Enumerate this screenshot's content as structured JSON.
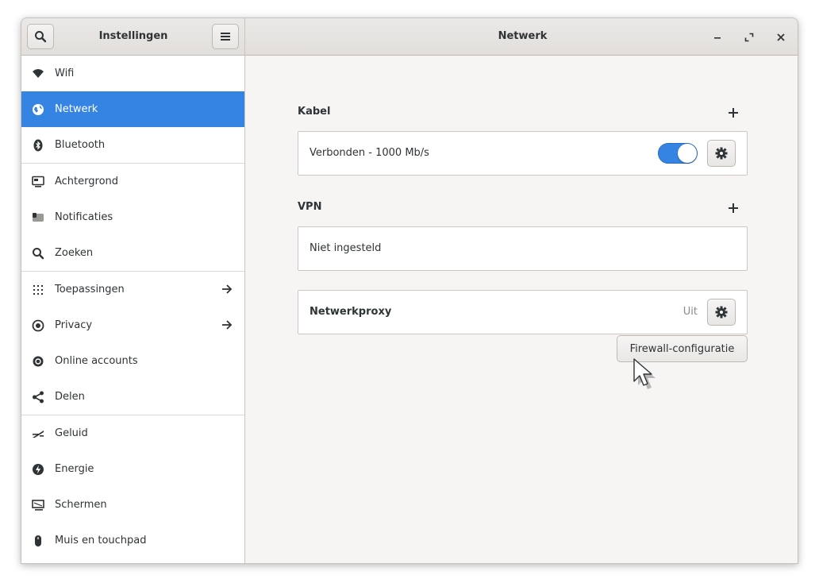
{
  "headerbar": {
    "sidebar_title": "Instellingen",
    "main_title": "Netwerk",
    "search_icon": "search-icon",
    "menu_icon": "hamburger-menu-icon",
    "controls": [
      "minimize-icon",
      "maximize-icon",
      "close-icon"
    ]
  },
  "sidebar": {
    "items": [
      {
        "label": "Wifi",
        "icon": "wifi-icon"
      },
      {
        "label": "Netwerk",
        "icon": "network-globe-icon",
        "selected": true
      },
      {
        "label": "Bluetooth",
        "icon": "bluetooth-icon"
      },
      {
        "label": "Achtergrond",
        "icon": "background-icon"
      },
      {
        "label": "Notificaties",
        "icon": "notifications-icon"
      },
      {
        "label": "Zoeken",
        "icon": "search-icon"
      },
      {
        "label": "Toepassingen",
        "icon": "applications-grid-icon",
        "arrow": true
      },
      {
        "label": "Privacy",
        "icon": "privacy-icon",
        "arrow": true
      },
      {
        "label": "Online accounts",
        "icon": "at-sign-icon"
      },
      {
        "label": "Delen",
        "icon": "share-icon"
      },
      {
        "label": "Geluid",
        "icon": "sound-icon"
      },
      {
        "label": "Energie",
        "icon": "power-icon"
      },
      {
        "label": "Schermen",
        "icon": "display-icon"
      },
      {
        "label": "Muis en touchpad",
        "icon": "mouse-icon"
      }
    ]
  },
  "main": {
    "wired": {
      "title": "Kabel",
      "status": "Verbonden - 1000 Mb/s",
      "switch_on": true
    },
    "vpn": {
      "title": "VPN",
      "status": "Niet ingesteld"
    },
    "proxy": {
      "label": "Netwerkproxy",
      "value": "Uit"
    },
    "firewall_button": "Firewall-configuratie"
  },
  "colors": {
    "accent": "#3584e4",
    "window_bg": "#f6f5f4",
    "header_bg": "#e1dedb"
  }
}
